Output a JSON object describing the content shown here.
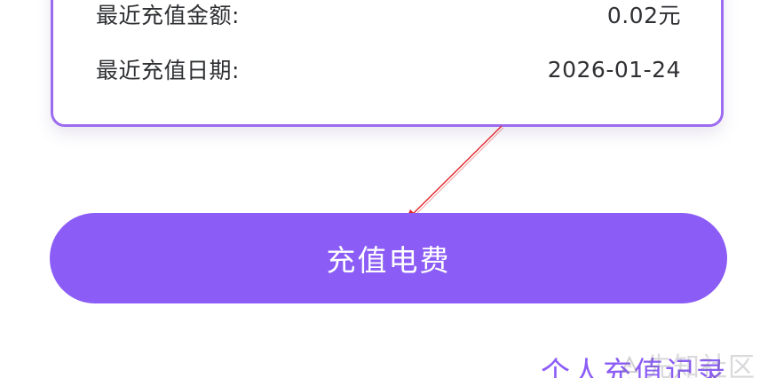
{
  "info": {
    "amount_label": "最近充值金额:",
    "amount_value": "0.02元",
    "date_label": "最近充值日期:",
    "date_value": "2026-01-24"
  },
  "actions": {
    "recharge_label": "充值电费",
    "history_label": "个人充值记录"
  },
  "watermark": {
    "text": "先知社区"
  },
  "colors": {
    "primary": "#8b5cf6",
    "card_border": "#9b6bf0",
    "annotation_arrow": "#e1262b"
  }
}
